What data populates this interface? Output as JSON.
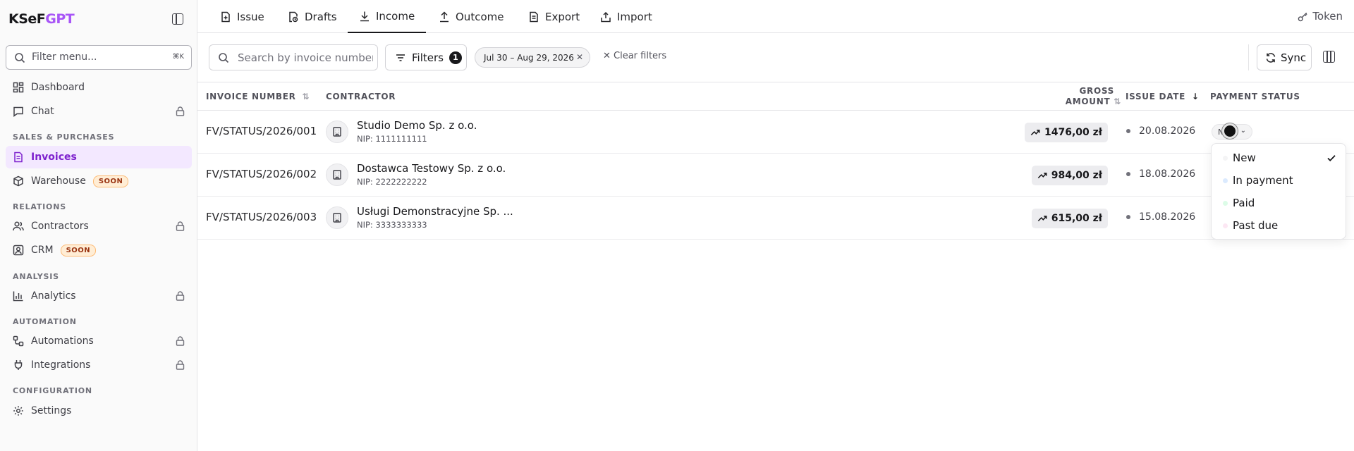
{
  "brand": {
    "prefix": "KSeF",
    "suffix": "GPT"
  },
  "sidebar": {
    "filter_placeholder": "Filter menu...",
    "filter_shortcut": "⌘K",
    "sections": {
      "sales": "SALES & PURCHASES",
      "relations": "RELATIONS",
      "analysis": "ANALYSIS",
      "automation": "AUTOMATION",
      "configuration": "CONFIGURATION"
    },
    "items": {
      "dashboard": "Dashboard",
      "chat": "Chat",
      "invoices": "Invoices",
      "warehouse": "Warehouse",
      "contractors": "Contractors",
      "crm": "CRM",
      "analytics": "Analytics",
      "automations": "Automations",
      "integrations": "Integrations",
      "settings": "Settings"
    },
    "soon_badge": "SOON"
  },
  "tabs": [
    "Issue",
    "Drafts",
    "Income",
    "Outcome",
    "Export",
    "Import"
  ],
  "active_tab": "Income",
  "token_label": "Token",
  "toolbar": {
    "search_placeholder": "Search by invoice number...",
    "filters_label": "Filters",
    "filters_count": "1",
    "date_chip": "Jul 30 – Aug 29, 2026",
    "clear_filters": "Clear filters",
    "sync_label": "Sync"
  },
  "table": {
    "headers": {
      "invoice_number": "INVOICE NUMBER",
      "contractor": "CONTRACTOR",
      "gross_line1": "GROSS",
      "gross_line2": "AMOUNT",
      "issue_date": "ISSUE DATE",
      "payment_status": "PAYMENT STATUS"
    },
    "rows": [
      {
        "number": "FV/STATUS/2026/001",
        "contractor": "Studio Demo Sp. z o.o.",
        "nip": "NIP: 1111111111",
        "amount": "1476,00 zł",
        "date": "20.08.2026"
      },
      {
        "number": "FV/STATUS/2026/002",
        "contractor": "Dostawca Testowy Sp. z o.o.",
        "nip": "NIP: 2222222222",
        "amount": "984,00 zł",
        "date": "18.08.2026"
      },
      {
        "number": "FV/STATUS/2026/003",
        "contractor": "Usługi Demonstracyjne Sp. ...",
        "nip": "NIP: 3333333333",
        "amount": "615,00 zł",
        "date": "15.08.2026"
      }
    ]
  },
  "status_trigger": "N",
  "status_options": [
    {
      "label": "New",
      "color": "#f4f4f5",
      "selected": true
    },
    {
      "label": "In payment",
      "color": "#dbeafe",
      "selected": false
    },
    {
      "label": "Paid",
      "color": "#dcfce7",
      "selected": false
    },
    {
      "label": "Past due",
      "color": "#fce7f3",
      "selected": false
    }
  ],
  "colors": {
    "accent": "#a855f7",
    "active_bg": "#f3e8ff",
    "active_text": "#7e22ce"
  }
}
